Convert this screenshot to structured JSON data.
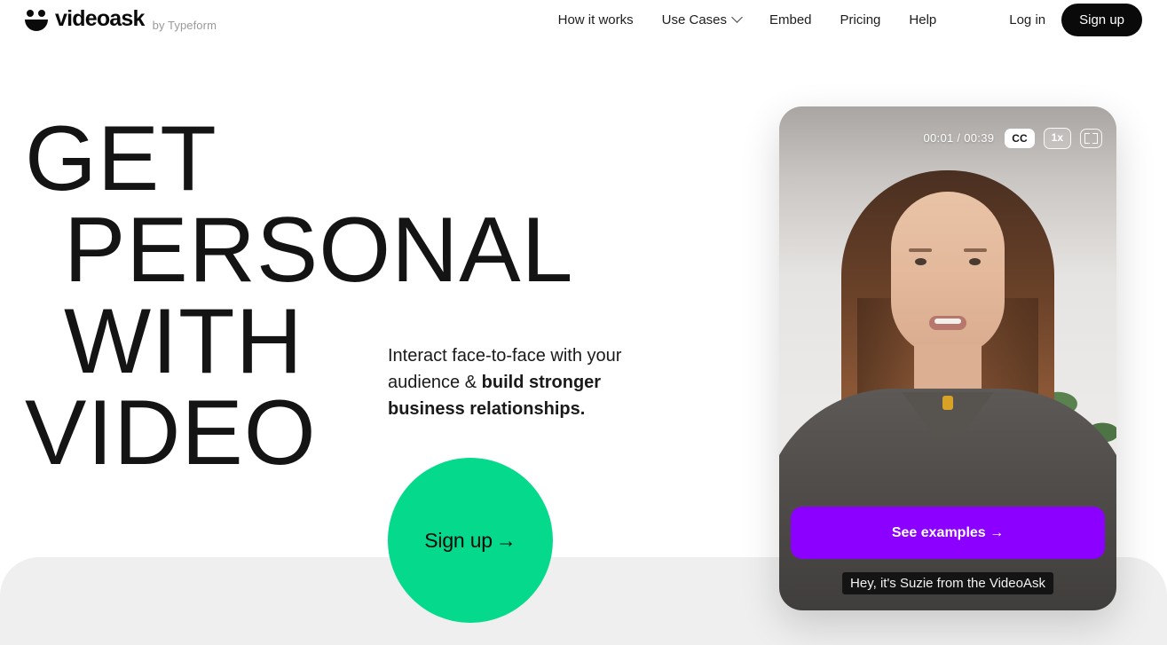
{
  "header": {
    "brand": {
      "logo_icon": "smiley-face-icon",
      "name": "videoask",
      "byline": "by Typeform"
    },
    "nav": [
      {
        "label": "How it works",
        "has_dropdown": false
      },
      {
        "label": "Use Cases",
        "has_dropdown": true,
        "icon": "chevron-down-icon"
      },
      {
        "label": "Embed",
        "has_dropdown": false
      },
      {
        "label": "Pricing",
        "has_dropdown": false
      },
      {
        "label": "Help",
        "has_dropdown": false
      }
    ],
    "login_label": "Log in",
    "signup_label": "Sign up"
  },
  "hero": {
    "title_lines": [
      "GET",
      "PERSONAL",
      "WITH",
      "VIDEO"
    ],
    "copy_lead": "Interact face-to-face with your audience & ",
    "copy_bold": "build stronger business relationships.",
    "cta_label": "Sign up",
    "cta_arrow": "→"
  },
  "video": {
    "time_current": "00:01",
    "time_separator": "/",
    "time_total": "00:39",
    "time_display": "00:01 / 00:39",
    "cc_label": "CC",
    "speed_label": "1x",
    "fullscreen_icon": "fullscreen-icon",
    "cta_label": "See examples →",
    "caption": "Hey, it's Suzie from the VideoAsk"
  },
  "colors": {
    "accent_green": "#05D98C",
    "accent_purple": "#8C00FF",
    "ink": "#0a0a0a",
    "gray_section": "#efefef"
  }
}
